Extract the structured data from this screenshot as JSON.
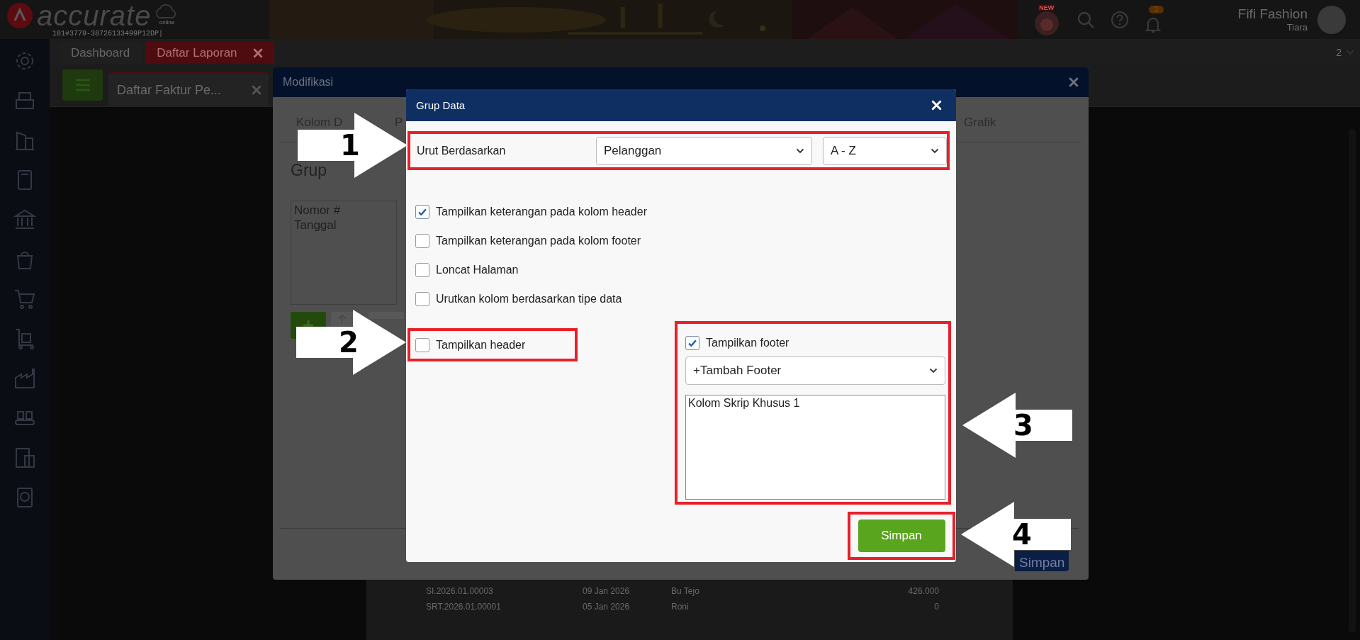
{
  "header": {
    "logo": "accurate",
    "logo_sub": "online",
    "account_id": "101#3779-38726133499P12DP|",
    "new_badge": "NEW",
    "notification_count": "2",
    "company": "Fifi Fashion",
    "user": "Tiara"
  },
  "tabs": [
    {
      "label": "Dashboard",
      "selected": false
    },
    {
      "label": "Daftar Laporan",
      "selected": true
    }
  ],
  "page_number": "2",
  "sub_tabs": [
    {
      "label": "Daftar Faktur Pe...",
      "selected": true
    }
  ],
  "report_rows": [
    {
      "number": "SI.2026.01.00003",
      "date": "09 Jan 2026",
      "customer": "Bu Tejo",
      "amount": "426.000"
    },
    {
      "number": "SRT.2026.01.00001",
      "date": "05 Jan 2026",
      "customer": "Roni",
      "amount": "0"
    }
  ],
  "modify_dialog": {
    "title": "Modifikasi",
    "tabs": [
      {
        "label": "Kolom D",
        "selected": false
      },
      {
        "label": "P",
        "selected": false
      },
      {
        "label": "Grafik",
        "selected": false
      }
    ],
    "section": "Grup",
    "group_fields": [
      "Nomor #",
      "Tanggal"
    ],
    "save": "Simpan"
  },
  "group_dialog": {
    "title": "Grup Data",
    "sort_label": "Urut Berdasarkan",
    "sort_field": "Pelanggan",
    "sort_order": "A - Z",
    "options": [
      {
        "label": "Tampilkan keterangan pada kolom header",
        "checked": true
      },
      {
        "label": "Tampilkan keterangan pada kolom footer",
        "checked": false
      },
      {
        "label": "Loncat Halaman",
        "checked": false
      },
      {
        "label": "Urutkan kolom berdasarkan tipe data",
        "checked": false
      }
    ],
    "show_header": {
      "label": "Tampilkan header",
      "checked": false
    },
    "show_footer": {
      "label": "Tampilkan footer",
      "checked": true
    },
    "add_footer": "+Tambah Footer",
    "footer_items": [
      "Kolom Skrip Khusus 1"
    ],
    "save": "Simpan"
  },
  "callouts": [
    {
      "number": "1",
      "kind": "right"
    },
    {
      "number": "2",
      "kind": "right"
    },
    {
      "number": "3",
      "kind": "left"
    },
    {
      "number": "4",
      "kind": "left"
    }
  ]
}
